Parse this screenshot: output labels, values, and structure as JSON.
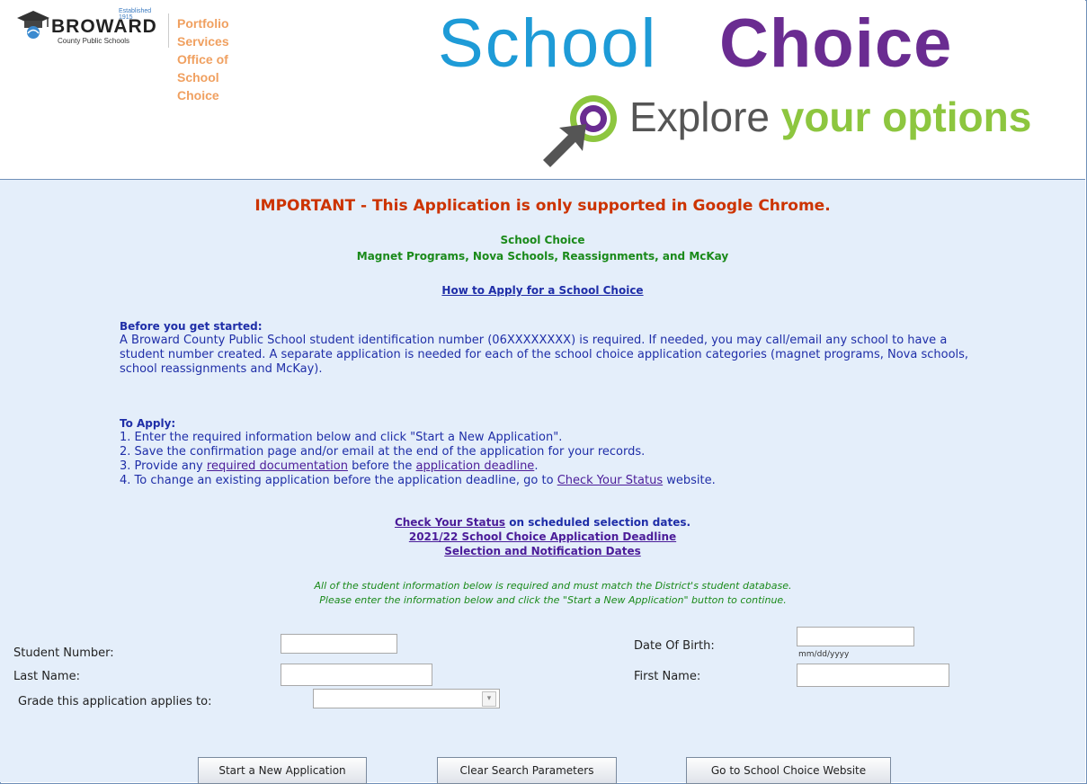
{
  "header": {
    "logo_established": "Established 1915",
    "logo_title": "BROWARD",
    "logo_subtitle": "County Public Schools",
    "dept_line1": "Portfolio Services",
    "dept_line2": "Office of School Choice",
    "brand_school": "School",
    "brand_choice": "Choice",
    "tagline_prefix": "Explore ",
    "tagline_highlight": "your options"
  },
  "main": {
    "important": "IMPORTANT - This Application is only supported in Google Chrome.",
    "program_title": "School Choice",
    "program_subtitle": "Magnet Programs, Nova Schools, Reassignments, and McKay",
    "how_to_apply_link": "How to Apply for a School Choice",
    "before_heading": "Before you get started:",
    "before_text": "A Broward County Public School student identification number (06XXXXXXXX) is required. If needed, you may call/email any school to have a student number created. A separate application is needed for each of the school choice application categories (magnet programs, Nova schools, school reassignments and McKay).",
    "to_apply_heading": "To Apply:",
    "step1": "1. Enter the required information below and click \"Start a New Application\".",
    "step2": "2. Save the confirmation page and/or email at the end of the application for your records.",
    "step3_prefix": "3. Provide any ",
    "step3_link1": "required documentation",
    "step3_mid": " before the ",
    "step3_link2": "application deadline",
    "step3_suffix": ".",
    "step4_prefix": "4. To change an existing application before the application deadline, go to ",
    "step4_link": "Check Your Status",
    "step4_suffix": " website.",
    "status_link": "Check Your Status",
    "status_suffix": " on scheduled selection dates.",
    "deadline_link": "2021/22 School Choice Application Deadline",
    "selection_link": "Selection and Notification Dates",
    "note_line1": "All of the student information below is required and must match the District's student database.",
    "note_line2": "Please enter the information below and click the \"Start a New Application\" button to continue."
  },
  "form": {
    "student_number_label": "Student Number:",
    "student_number_value": "",
    "dob_label": "Date Of Birth:",
    "dob_value": "",
    "dob_hint": "mm/dd/yyyy",
    "last_name_label": "Last Name:",
    "last_name_value": "",
    "first_name_label": "First Name:",
    "first_name_value": "",
    "grade_label": "Grade this application applies to:",
    "grade_value": "",
    "start_button": "Start a New Application",
    "clear_button": "Clear Search Parameters",
    "website_button": "Go to School Choice Website"
  },
  "colors": {
    "important_red": "#cc3300",
    "heading_green": "#1a8a1a",
    "link_purple": "#4b1c99",
    "text_navy": "#1f2ea8",
    "panel_bg": "#e4eefa",
    "brand_blue": "#1e9bd7",
    "brand_purple": "#6a2c91",
    "brand_green": "#8dc63f"
  },
  "icons": [
    "graduation-cap-icon",
    "cursor-arrow-icon",
    "target-circle-icon",
    "dropdown-arrow-icon"
  ]
}
